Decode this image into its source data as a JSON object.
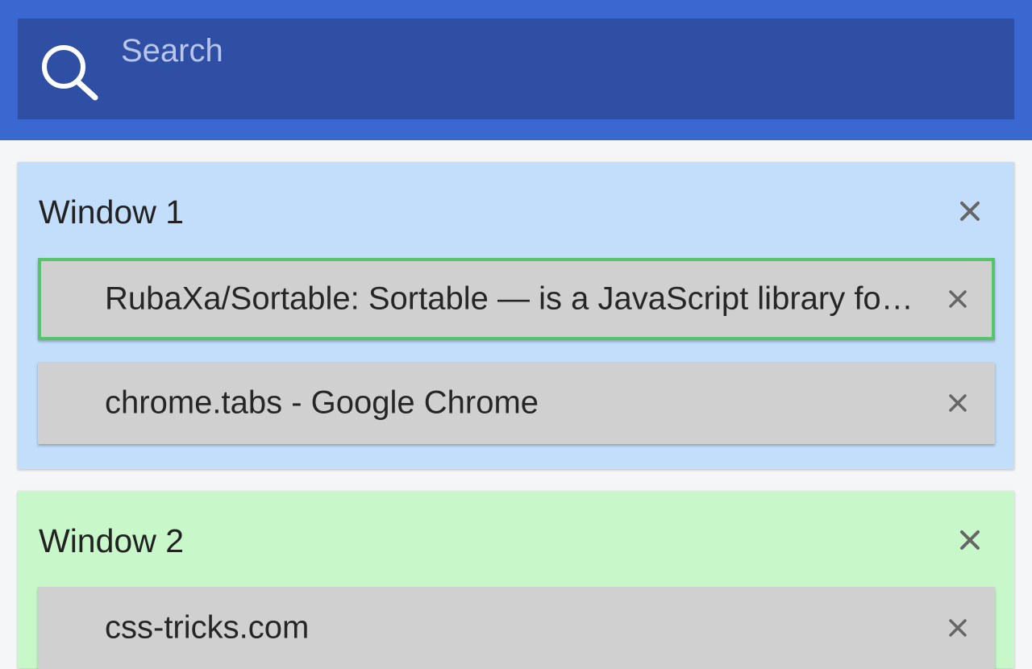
{
  "search": {
    "placeholder": "Search",
    "value": ""
  },
  "colors": {
    "header_bg": "#3b67d0",
    "search_bg": "#2e4fa3",
    "window_1_bg": "#c2defa",
    "window_2_bg": "#c8f8ca",
    "tab_bg": "#d0d0d0",
    "active_border": "#55c46a"
  },
  "windows": [
    {
      "title": "Window 1",
      "tabs": [
        {
          "title": "RubaXa/Sortable: Sortable — is a JavaScript library for reorderable drag-and-drop lists",
          "active": true
        },
        {
          "title": "chrome.tabs - Google Chrome",
          "active": false
        }
      ]
    },
    {
      "title": "Window 2",
      "tabs": [
        {
          "title": "css-tricks.com",
          "active": false
        }
      ]
    }
  ]
}
